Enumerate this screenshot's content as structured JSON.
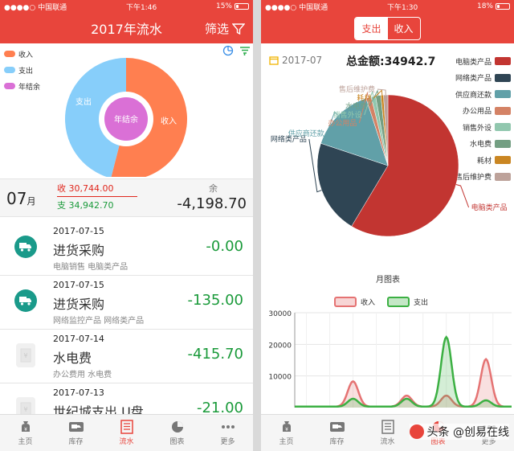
{
  "left": {
    "status": {
      "carrier": "●●●●○ 中国联通",
      "time": "下午1:46",
      "battery": "15%"
    },
    "nav": {
      "title": "2017年流水",
      "filter_label": "筛选"
    },
    "legend": [
      {
        "label": "收入",
        "color": "#ff7f50"
      },
      {
        "label": "支出",
        "color": "#87cefa"
      },
      {
        "label": "年结余",
        "color": "#da70d6"
      }
    ],
    "donut": {
      "expense_label": "支出",
      "income_label": "收入",
      "balance_label": "年结余",
      "income_share": 0.54
    },
    "summary": {
      "month": "07",
      "month_unit": "月",
      "income": "收 30,744.00",
      "expense": "支 34,942.70",
      "balance_label": "余",
      "balance": "-4,198.70"
    },
    "rows": [
      {
        "date": "2017-07-15",
        "title": "进货采购",
        "sub": "电脑销售 电脑类产品",
        "amount": "-0.00",
        "icon": "truck-icon"
      },
      {
        "date": "2017-07-15",
        "title": "进货采购",
        "sub": "网络监控产品 网络类产品",
        "amount": "-135.00",
        "icon": "truck-icon"
      },
      {
        "date": "2017-07-14",
        "title": "水电费",
        "sub": "办公费用 水电费",
        "amount": "-415.70",
        "icon": "receipt-icon"
      },
      {
        "date": "2017-07-13",
        "title": "世纪城支出 U盘",
        "sub": "",
        "amount": "-21.00",
        "icon": "receipt-icon"
      }
    ],
    "tabs": [
      {
        "label": "主页",
        "icon": "money-bag-icon",
        "active": false
      },
      {
        "label": "库存",
        "icon": "truck-icon",
        "active": false
      },
      {
        "label": "流水",
        "icon": "ledger-icon",
        "active": true
      },
      {
        "label": "图表",
        "icon": "pie-chart-icon",
        "active": false
      },
      {
        "label": "更多",
        "icon": "more-icon",
        "active": false
      }
    ]
  },
  "right": {
    "status": {
      "carrier": "●●●●○ 中国联通",
      "time": "下午1:30",
      "battery": "18%"
    },
    "segment": {
      "expense": "支出",
      "income": "收入"
    },
    "period": "2017-07",
    "total": "总金额:34942.7",
    "tabs": [
      {
        "label": "主页",
        "icon": "money-bag-icon",
        "active": false
      },
      {
        "label": "库存",
        "icon": "truck-icon",
        "active": false
      },
      {
        "label": "流水",
        "icon": "ledger-icon",
        "active": false
      },
      {
        "label": "图表",
        "icon": "pie-chart-icon",
        "active": true
      },
      {
        "label": "更多",
        "icon": "more-icon",
        "active": false
      }
    ],
    "watermark": "头条 @创易在线"
  },
  "chart_data": [
    {
      "type": "pie",
      "categories": [
        "电脑类产品",
        "网络类产品",
        "供应商还款",
        "办公用品",
        "销售外设",
        "水电费",
        "耗材",
        "售后维护费"
      ],
      "values": [
        58.6,
        21.5,
        14.9,
        1.2,
        1.0,
        1.2,
        0.6,
        1.0
      ],
      "colors": [
        "#c23531",
        "#2f4554",
        "#61a0a8",
        "#d48265",
        "#91c7ae",
        "#749f83",
        "#ca8622",
        "#bda29a"
      ],
      "legend_position": "right"
    },
    {
      "type": "area",
      "title": "月图表",
      "series": [
        {
          "name": "收入",
          "color": "#e57373",
          "peaks": [
            {
              "x": 2.5,
              "y": 8000
            },
            {
              "x": 4.8,
              "y": 3500
            },
            {
              "x": 6.5,
              "y": 3500
            },
            {
              "x": 8.2,
              "y": 15000
            }
          ]
        },
        {
          "name": "支出",
          "color": "#3cb043",
          "peaks": [
            {
              "x": 2.5,
              "y": 2500
            },
            {
              "x": 4.8,
              "y": 2500
            },
            {
              "x": 6.5,
              "y": 22000
            },
            {
              "x": 8.2,
              "y": 2000
            }
          ]
        }
      ],
      "yticks": [
        "30000",
        "20000",
        "10000"
      ],
      "ylim": [
        0,
        30000
      ],
      "xlim": [
        0,
        9.3
      ],
      "legend_position": "top",
      "grid": true
    }
  ]
}
